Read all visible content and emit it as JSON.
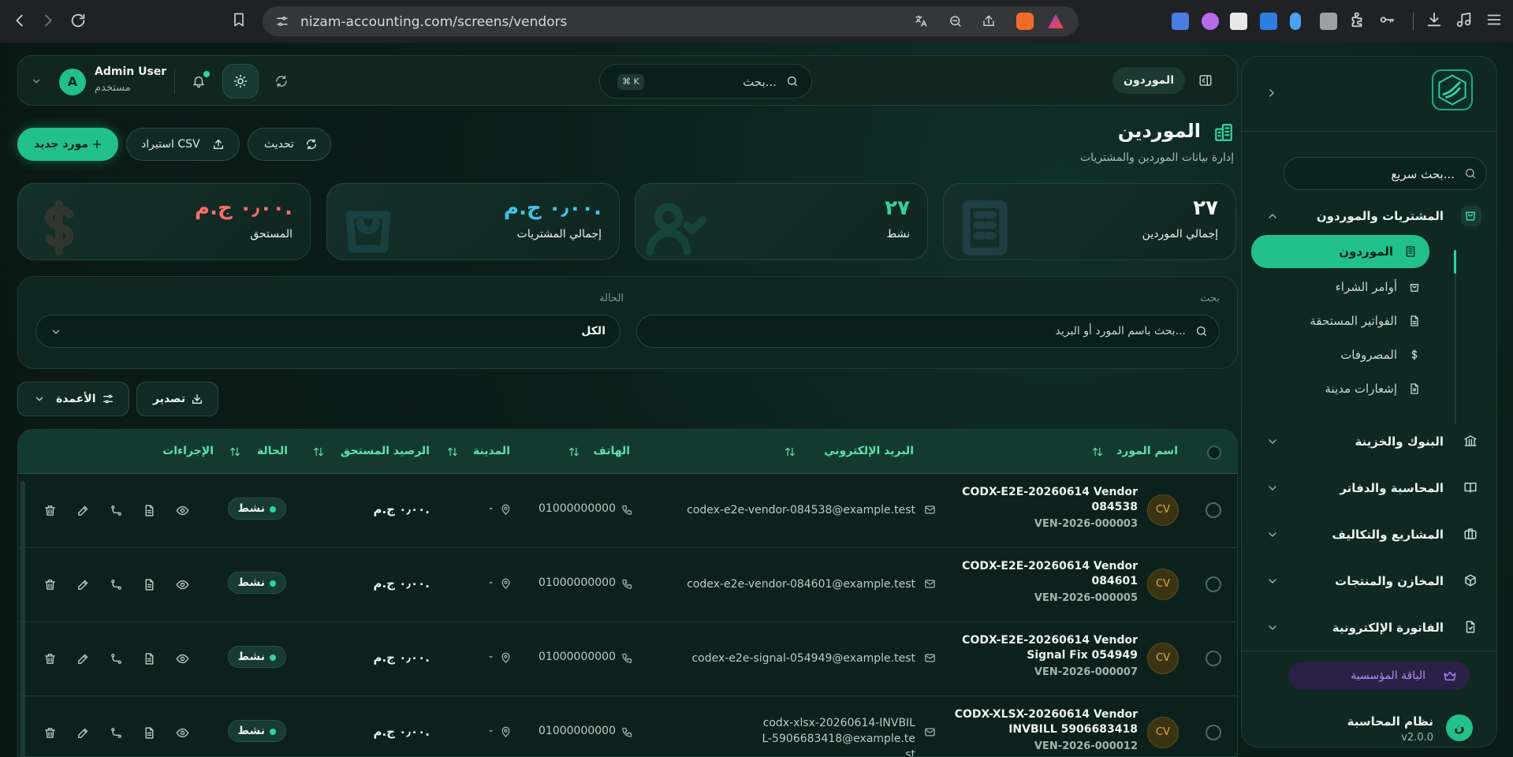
{
  "browser": {
    "url": "nizam-accounting.com/screens/vendors"
  },
  "topbar": {
    "user_name": "Admin User",
    "user_role": "مستخدم",
    "avatar_letter": "A",
    "search_placeholder": "بحث...",
    "search_shortcut": "⌘ K",
    "breadcrumb": "الموردون"
  },
  "sidebar": {
    "search_placeholder": "بحث سريع...",
    "groups": [
      {
        "label": "المشتريات والموردون",
        "icon": "shopping-bag-icon",
        "open": true
      },
      {
        "label": "البنوك والخزينة",
        "icon": "bank-icon"
      },
      {
        "label": "المحاسبة والدفاتر",
        "icon": "book-icon"
      },
      {
        "label": "المشاريع والتكاليف",
        "icon": "briefcase-icon"
      },
      {
        "label": "المخازن والمنتجات",
        "icon": "box-icon"
      },
      {
        "label": "الفاتورة الإلكترونية",
        "icon": "e-invoice-icon"
      }
    ],
    "items": [
      {
        "label": "الموردون",
        "icon": "building-icon",
        "active": true
      },
      {
        "label": "أوامر الشراء",
        "icon": "bag-icon"
      },
      {
        "label": "الفواتير المستحقة",
        "icon": "file-icon"
      },
      {
        "label": "المصروفات",
        "icon": "dollar-icon"
      },
      {
        "label": "إشعارات مدينة",
        "icon": "file-x-icon"
      }
    ],
    "plan": "الباقة المؤسسية",
    "system_name": "نظام المحاسبة",
    "version": "v2.0.0",
    "system_letter": "ن"
  },
  "header": {
    "title": "الموردين",
    "subtitle": "إدارة بيانات الموردين والمشتريات",
    "new_vendor": "مورد جديد",
    "import_csv": "استيراد CSV",
    "refresh": "تحديث"
  },
  "stats": [
    {
      "value": "٢٧",
      "label": "إجمالي الموردين",
      "color": "#f1f7f4"
    },
    {
      "value": "٢٧",
      "label": "نشط",
      "color": "#34d39a"
    },
    {
      "value": "٠٫٠٠ ج.م.",
      "label": "إجمالي المشتريات",
      "color": "#3fc3e8"
    },
    {
      "value": "٠٫٠٠ ج.م.",
      "label": "المستحق",
      "color": "#ff6b6b"
    }
  ],
  "filters": {
    "search_label": "بحث",
    "search_placeholder": "بحث باسم المورد أو البريد...",
    "status_label": "الحالة",
    "status_value": "الكل"
  },
  "actions": {
    "export": "تصدير",
    "columns": "الأعمدة"
  },
  "table": {
    "columns": [
      "اسم المورد",
      "البريد الإلكتروني",
      "الهاتف",
      "المدينة",
      "الرصيد المستحق",
      "الحالة",
      "الإجراءات"
    ],
    "rows": [
      {
        "initials": "CV",
        "name": "CODX-E2E-20260614 Vendor 084538",
        "code": "VEN-2026-000003",
        "email": "codex-e2e-vendor-084538@example.test",
        "phone": "01000000000",
        "city": "-",
        "balance": "٠٫٠٠ ج.م.",
        "status": "نشط"
      },
      {
        "initials": "CV",
        "name": "CODX-E2E-20260614 Vendor 084601",
        "code": "VEN-2026-000005",
        "email": "codex-e2e-vendor-084601@example.test",
        "phone": "01000000000",
        "city": "-",
        "balance": "٠٫٠٠ ج.م.",
        "status": "نشط"
      },
      {
        "initials": "CV",
        "name": "CODX-E2E-20260614 Vendor Signal Fix 054949",
        "code": "VEN-2026-000007",
        "email": "codex-e2e-signal-054949@example.test",
        "phone": "01000000000",
        "city": "-",
        "balance": "٠٫٠٠ ج.م.",
        "status": "نشط"
      },
      {
        "initials": "CV",
        "name": "CODX-XLSX-20260614 Vendor INVBILL 5906683418",
        "code": "VEN-2026-000012",
        "email": "codx-xlsx-20260614-INVBILL-5906683418@example.test",
        "phone": "01000000000",
        "city": "-",
        "balance": "٠٫٠٠ ج.م.",
        "status": "نشط"
      }
    ]
  }
}
